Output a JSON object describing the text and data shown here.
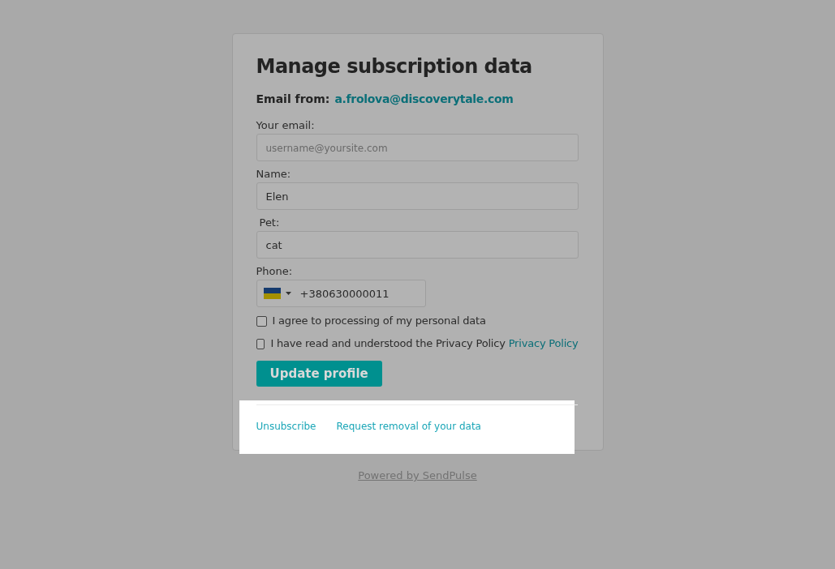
{
  "title": "Manage subscription data",
  "email_from": {
    "label": "Email from:",
    "address": "a.frolova@discoverytale.com"
  },
  "fields": [
    {
      "kind": "text",
      "label": "Your email:",
      "placeholder": "username@yoursite.com"
    },
    {
      "kind": "text",
      "label": "Name:",
      "value": "Elen"
    },
    {
      "kind": "text",
      "label": "Pet:",
      "value": "cat"
    },
    {
      "kind": "phone",
      "label": "Phone:",
      "value": "+380630000011"
    }
  ],
  "consents": [
    {
      "text": "I agree to processing of my personal data",
      "checked": false
    },
    {
      "text": "I have read and understood the Privacy Policy",
      "link": "Privacy Policy",
      "checked": false
    }
  ],
  "submit_button": "Update profile",
  "footer_links": [
    "Unsubscribe",
    "Request removal of your data"
  ],
  "powered_by": "Powered by SendPulse"
}
